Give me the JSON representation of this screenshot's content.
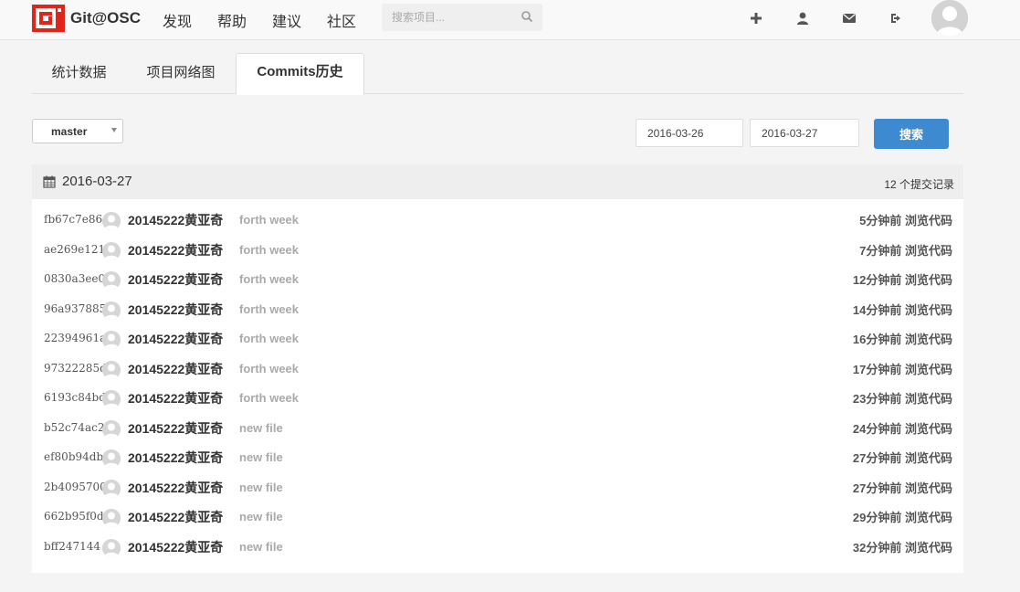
{
  "navbar": {
    "brand": "Git@OSC",
    "links": [
      "发现",
      "帮助",
      "建议",
      "社区"
    ],
    "search_placeholder": "搜索项目..."
  },
  "tabs": [
    "统计数据",
    "项目网络图",
    "Commits历史"
  ],
  "filters": {
    "branch": "master",
    "date_from": "2016-03-26",
    "date_to": "2016-03-27",
    "search_label": "搜索"
  },
  "day": {
    "date": "2016-03-27",
    "count_label": "12 个提交记录"
  },
  "commits": [
    {
      "sha": "fb67c7e86",
      "author": "20145222黄亚奇",
      "message": "forth week",
      "time": "5分钟前",
      "browse": "浏览代码"
    },
    {
      "sha": "ae269e121",
      "author": "20145222黄亚奇",
      "message": "forth week",
      "time": "7分钟前",
      "browse": "浏览代码"
    },
    {
      "sha": "0830a3ee0",
      "author": "20145222黄亚奇",
      "message": "forth week",
      "time": "12分钟前",
      "browse": "浏览代码"
    },
    {
      "sha": "96a937885",
      "author": "20145222黄亚奇",
      "message": "forth week",
      "time": "14分钟前",
      "browse": "浏览代码"
    },
    {
      "sha": "22394961a",
      "author": "20145222黄亚奇",
      "message": "forth week",
      "time": "16分钟前",
      "browse": "浏览代码"
    },
    {
      "sha": "97322285d",
      "author": "20145222黄亚奇",
      "message": "forth week",
      "time": "17分钟前",
      "browse": "浏览代码"
    },
    {
      "sha": "6193c84bd",
      "author": "20145222黄亚奇",
      "message": "forth week",
      "time": "23分钟前",
      "browse": "浏览代码"
    },
    {
      "sha": "b52c74ac2",
      "author": "20145222黄亚奇",
      "message": "new file",
      "time": "24分钟前",
      "browse": "浏览代码"
    },
    {
      "sha": "ef80b94db",
      "author": "20145222黄亚奇",
      "message": "new file",
      "time": "27分钟前",
      "browse": "浏览代码"
    },
    {
      "sha": "2b4095700",
      "author": "20145222黄亚奇",
      "message": "new file",
      "time": "27分钟前",
      "browse": "浏览代码"
    },
    {
      "sha": "662b95f0d",
      "author": "20145222黄亚奇",
      "message": "new file",
      "time": "29分钟前",
      "browse": "浏览代码"
    },
    {
      "sha": "bff247144",
      "author": "20145222黄亚奇",
      "message": "new file",
      "time": "32分钟前",
      "browse": "浏览代码"
    }
  ],
  "colors": {
    "brand_red": "#e0251b",
    "primary_blue": "#3e8ad0"
  }
}
